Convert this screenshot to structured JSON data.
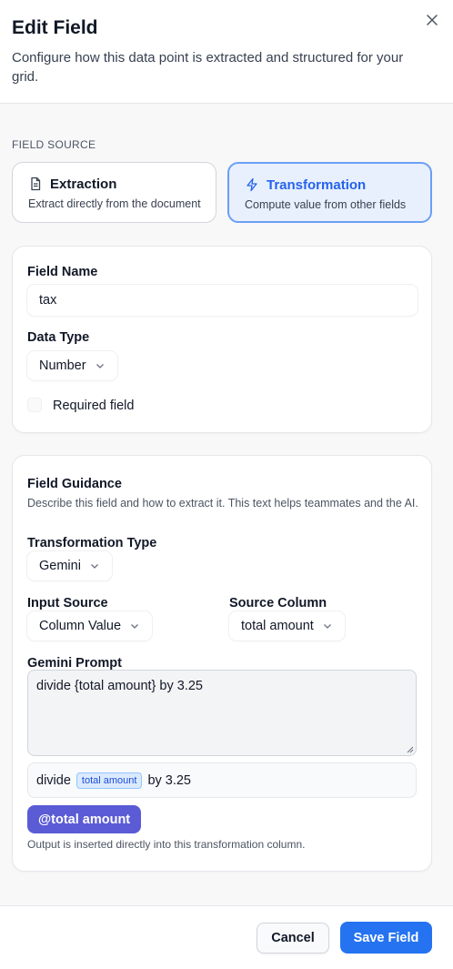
{
  "dialog": {
    "title": "Edit Field",
    "subtitle": "Configure how this data point is extracted and structured for your grid.",
    "close_icon": "close-icon"
  },
  "field_source": {
    "section_label": "FIELD SOURCE",
    "options": [
      {
        "title": "Extraction",
        "description": "Extract directly from the document",
        "icon": "document-icon",
        "selected": false
      },
      {
        "title": "Transformation",
        "description": "Compute value from other fields",
        "icon": "lightning-icon",
        "selected": true
      }
    ]
  },
  "basics": {
    "field_name_label": "Field Name",
    "field_name_value": "tax",
    "data_type_label": "Data Type",
    "data_type_value": "Number",
    "required_label": "Required field",
    "required_checked": false
  },
  "guidance": {
    "title": "Field Guidance",
    "help": "Describe this field and how to extract it. This text helps teammates and the AI.",
    "transformation_type_label": "Transformation Type",
    "transformation_type_value": "Gemini",
    "input_source_label": "Input Source",
    "input_source_value": "Column Value",
    "source_column_label": "Source Column",
    "source_column_value": "total amount",
    "prompt_label": "Gemini Prompt",
    "prompt_value": "divide {total amount} by 3.25",
    "preview": {
      "before": "divide",
      "chip": "total amount",
      "after": "by 3.25"
    },
    "mention_button": "@total amount",
    "output_note": "Output is inserted directly into this transformation column."
  },
  "footer": {
    "cancel_label": "Cancel",
    "save_label": "Save Field"
  },
  "colors": {
    "primary": "#2573f0",
    "mention": "#5b5bd6",
    "selected_card_bg": "#e8f0fe",
    "selected_card_border": "#6b9ff5"
  }
}
